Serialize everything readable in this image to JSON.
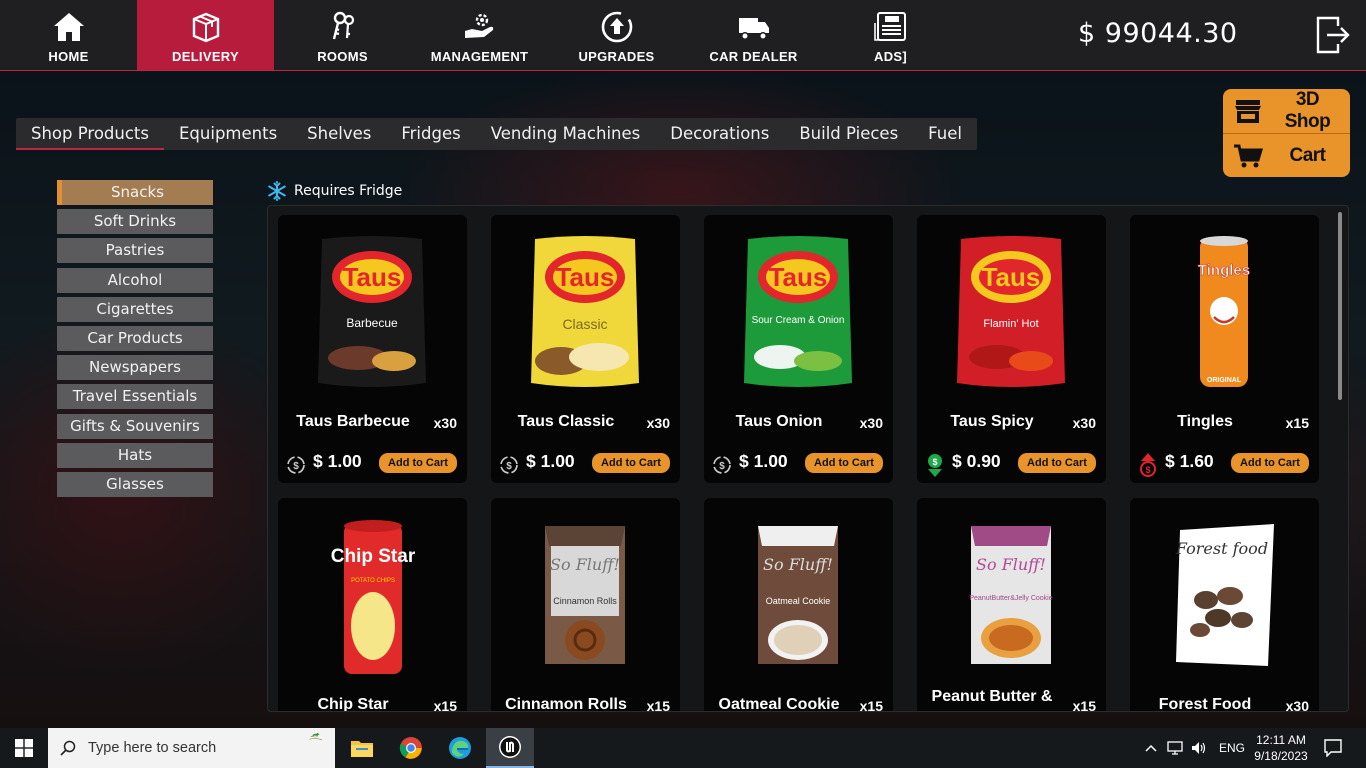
{
  "nav": {
    "items": [
      {
        "label": "HOME",
        "icon": "home-icon"
      },
      {
        "label": "DELIVERY",
        "icon": "delivery-box-icon",
        "active": true
      },
      {
        "label": "ROOMS",
        "icon": "keys-icon"
      },
      {
        "label": "MANAGEMENT",
        "icon": "hand-gear-icon"
      },
      {
        "label": "UPGRADES",
        "icon": "upgrade-arrow-icon"
      },
      {
        "label": "CAR DEALER",
        "icon": "truck-icon"
      },
      {
        "label": "ADS]",
        "icon": "ads-newspaper-icon"
      }
    ],
    "money": "$ 99044.30",
    "accent": "#b81c3d"
  },
  "shop_buttons": {
    "shop3d": "3D Shop",
    "cart": "Cart",
    "color": "#e8942a"
  },
  "tabs": [
    "Shop Products",
    "Equipments",
    "Shelves",
    "Fridges",
    "Vending Machines",
    "Decorations",
    "Build Pieces",
    "Fuel"
  ],
  "active_tab": "Shop Products",
  "subcategories": [
    "Snacks",
    "Soft Drinks",
    "Pastries",
    "Alcohol",
    "Cigarettes",
    "Car Products",
    "Newspapers",
    "Travel Essentials",
    "Gifts & Souvenirs",
    "Hats",
    "Glasses"
  ],
  "active_subcategory": "Snacks",
  "fridge_note": "Requires Fridge",
  "products": [
    {
      "name": "Taus Barbecue",
      "qty": "x30",
      "price": "$ 1.00",
      "trend": "stable",
      "pack": "Taus",
      "flavor": "Barbecue",
      "color": "#1a1a1a"
    },
    {
      "name": "Taus Classic",
      "qty": "x30",
      "price": "$ 1.00",
      "trend": "stable",
      "pack": "Taus",
      "flavor": "Classic",
      "color": "#f1d83a"
    },
    {
      "name": "Taus Onion",
      "qty": "x30",
      "price": "$ 1.00",
      "trend": "stable",
      "pack": "Taus",
      "flavor": "Sour Cream & Onion",
      "color": "#1d9a3a"
    },
    {
      "name": "Taus Spicy",
      "qty": "x30",
      "price": "$ 0.90",
      "trend": "down",
      "pack": "Taus",
      "flavor": "Flamin' Hot",
      "color": "#d21f27"
    },
    {
      "name": "Tingles",
      "qty": "x15",
      "price": "$ 1.60",
      "trend": "up",
      "pack": "Tingles",
      "flavor": "ORIGINAL",
      "color": "#f08a1e"
    },
    {
      "name": "Chip Star",
      "qty": "x15",
      "pack": "Chip Star",
      "flavor": "POTATO CHIPS",
      "color": "#e12a2a"
    },
    {
      "name": "Cinnamon Rolls",
      "qty": "x15",
      "pack": "So Fluff!",
      "flavor": "Cinnamon Rolls",
      "color": "#7a5a47"
    },
    {
      "name": "Oatmeal Cookie",
      "qty": "x15",
      "pack": "So Fluff!",
      "flavor": "Oatmeal Cookie",
      "color": "#6e4b3a"
    },
    {
      "name": "Peanut Butter &",
      "qty": "x15",
      "pack": "So Fluff!",
      "flavor": "PeanutButter&Jelly Cookie",
      "color": "#a04a86"
    },
    {
      "name": "Forest Food",
      "qty": "x30",
      "pack": "Forest food",
      "flavor": "",
      "color": "#ffffff"
    }
  ],
  "add_to_cart_label": "Add to Cart",
  "taskbar": {
    "search_placeholder": "Type here to search",
    "lang": "ENG",
    "time": "12:11 AM",
    "date": "9/18/2023"
  }
}
